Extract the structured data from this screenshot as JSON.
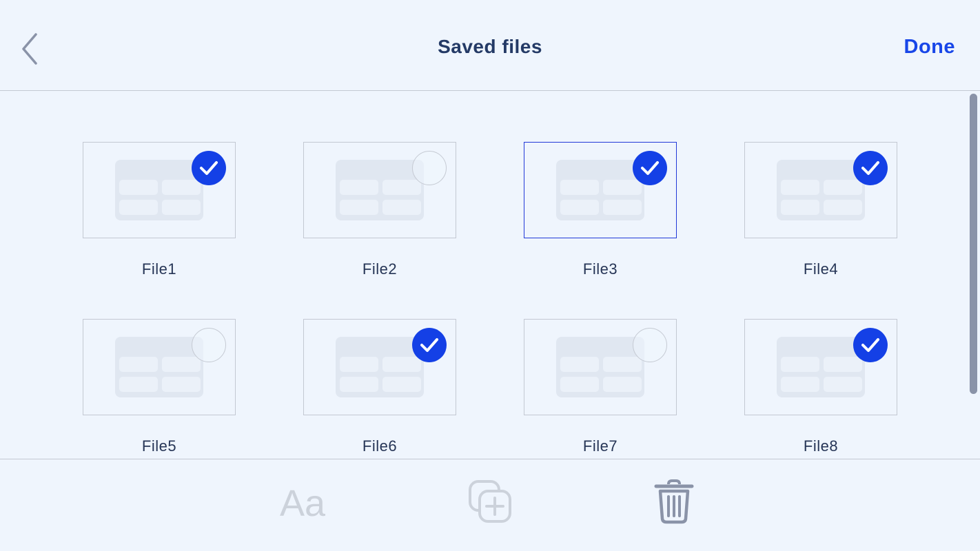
{
  "header": {
    "title": "Saved files",
    "done_label": "Done",
    "back_icon": "chevron-left-icon"
  },
  "files": [
    {
      "name": "File1",
      "selected": true
    },
    {
      "name": "File2",
      "selected": false
    },
    {
      "name": "File3",
      "selected": true,
      "focused": true
    },
    {
      "name": "File4",
      "selected": true
    },
    {
      "name": "File5",
      "selected": false
    },
    {
      "name": "File6",
      "selected": true
    },
    {
      "name": "File7",
      "selected": false
    },
    {
      "name": "File8",
      "selected": true
    }
  ],
  "toolbar": {
    "font_label": "Aa",
    "font_icon": "font-icon",
    "duplicate_icon": "duplicate-plus-icon",
    "delete_icon": "trash-icon"
  },
  "colors": {
    "accent": "#1440e6",
    "title": "#243a66",
    "background": "#eff5fd",
    "disabled": "#ccd2db",
    "trash": "#8a93a8"
  }
}
